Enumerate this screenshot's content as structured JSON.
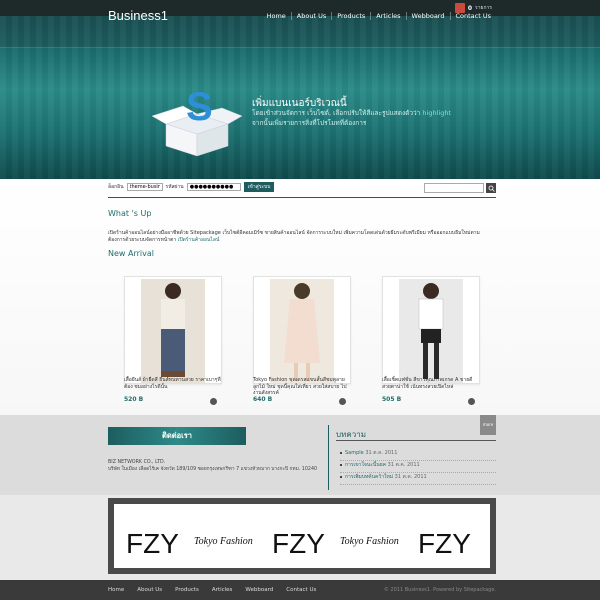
{
  "topbar": {
    "cart_count": "0",
    "cart_label": "รายการ"
  },
  "header": {
    "logo": "Business1",
    "nav": [
      "Home",
      "About Us",
      "Products",
      "Articles",
      "Webboard",
      "Contact Us"
    ],
    "banner_title": "เพิ่มแบนเนอร์บริเวณนี้",
    "banner_line1": "โดยเข้าส่วนจัดการ เว็บไซต์, เลือกปรับให้สีและรูปแสดงตัวว่า",
    "banner_highlight": "highlight",
    "banner_line2": "จากนั้นเพิ่มรายการสิ่งที่โปรโมทที่ต้องการ"
  },
  "login": {
    "user_label": "ล็อกอิน",
    "user_value": "theme-business",
    "pass_label": "รหัสผ่าน",
    "pass_value": "●●●●●●●●●●",
    "button": "เข้าสู่ระบบ"
  },
  "main": {
    "whats_up_title": "What 's Up",
    "intro": "เปิดร้านค้าออนไลน์อย่างมืออาชีพด้วย Sitepackage เว็บไซต์อีคอมเมิร์ซ ขายสินค้าออนไลน์ จัดการระบบใหม่ เพิ่มความโดดเด่นด้วยธีมระดับพรีเมียม หรือออกแบบธีมใหม่ตามต้องการด้วยระบบจัดการหน้าตา",
    "intro_link": "เปิดร้านค้าออนไลน์",
    "new_arrival_title": "New Arrival",
    "products": [
      {
        "desc": "เสื้อยีนส์ ผ้ายืดสี ยีนส์ทนทานสวย ราคาเบาๆที่ต้อง ชมอย่างไรดีนั้น",
        "price": "520 B"
      },
      {
        "desc": "Tokyo Fashion ชุดเดรสแขนสั้นสีชมพูลายลูกไม้ ใหม่ ชุดนี้คุณใส่เที่ยว สวยใส่สบาย ไปงานสังสรรค์",
        "price": "640 B"
      },
      {
        "desc": "เสื้อเชิ้ตแฟชั่น สีขาวคุณภาพเกรด A ขายดี สวยตาน่าใช้ เน้นทรงสวยเปิดไหล่",
        "price": "505 B"
      }
    ]
  },
  "lower": {
    "more_label": "more",
    "contact_title": "ติดต่อเรา",
    "company": "BIZ NETWORK CO., LTD.",
    "address": "บริษัท ในเมือง เลือดไร้เค จังหวัด 189/109 ซอยกรุงเทพกรีฑา 7 แขวงหัวหมาก บางกะปิ กทม. 10240",
    "articles_title": "บทความ",
    "articles": [
      {
        "title": "Sample",
        "date": "31 ต.ค. 2011"
      },
      {
        "title": "การเขาใจนะนี้นยค",
        "date": "31 ต.ค. 2011"
      },
      {
        "title": "การเพิ่มบทค้นคว้าใหม่",
        "date": "31 ต.ค. 2011"
      }
    ]
  },
  "ad": {
    "brand": "FZY",
    "script": "Tokyo Fashion"
  },
  "footer": {
    "nav": [
      "Home",
      "About Us",
      "Products",
      "Articles",
      "Webboard",
      "Contact Us"
    ],
    "copyright": "© 2011 Business1. Powered by Sitepackage."
  }
}
